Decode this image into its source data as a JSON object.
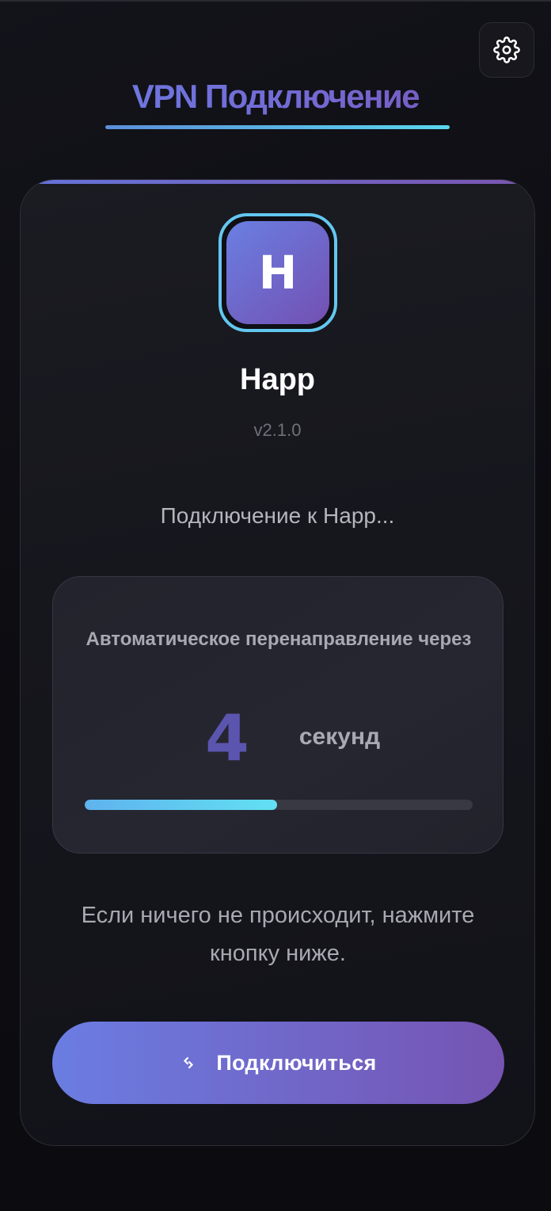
{
  "header": {
    "title": "VPN Подключение",
    "settings_icon": "gear-icon"
  },
  "app": {
    "logo_letter": "H",
    "name": "Happ",
    "version": "v2.1.0"
  },
  "status": {
    "text": "Подключение к Happ..."
  },
  "redirect": {
    "label": "Автоматическое перенаправление через",
    "countdown": "4",
    "unit": "секунд",
    "progress_percent": 49.5
  },
  "hint": {
    "text": "Если ничего не происходит, нажмите кнопку ниже."
  },
  "connect_button": {
    "label": "Подключиться",
    "icon": "link-icon"
  },
  "colors": {
    "accent_start": "#6b7de2",
    "accent_end": "#7554b2",
    "cyan": "#62e0f2"
  }
}
